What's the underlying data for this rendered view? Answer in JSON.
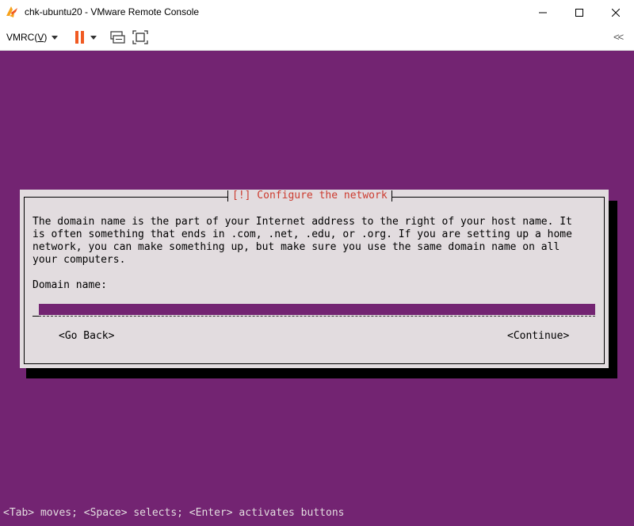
{
  "window": {
    "title": "chk-ubuntu20 - VMware Remote Console",
    "minimize_icon": "minimize-icon",
    "maximize_icon": "maximize-icon",
    "close_icon": "close-icon"
  },
  "toolbar": {
    "menu_label_prefix": "VMRC(",
    "menu_label_key": "V",
    "menu_label_suffix": ")",
    "pause_icon": "pause-icon",
    "send_keys_icon": "send-ctrl-alt-del-icon",
    "fullscreen_icon": "fullscreen-icon",
    "collapse_label": "<<",
    "accent_color": "#f05a22"
  },
  "console": {
    "background_color": "#732472",
    "dialog": {
      "title": "[!] Configure the network",
      "description": "The domain name is the part of your Internet address to the right of your host name.  It\nis often something that ends in .com, .net, .edu, or .org.  If you are setting up a home\nnetwork, you can make something up, but make sure you use the same domain name on all\nyour computers.",
      "field_label": "Domain name:",
      "field_value": "",
      "back_button": "<Go Back>",
      "continue_button": "<Continue>"
    },
    "status_line": "<Tab> moves; <Space> selects; <Enter> activates buttons"
  }
}
